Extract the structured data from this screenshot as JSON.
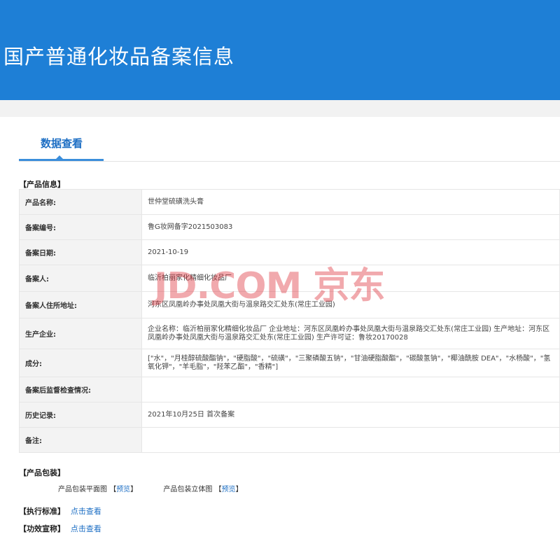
{
  "header": {
    "title": "国产普通化妆品备案信息"
  },
  "tabs": [
    {
      "label": "数据查看"
    }
  ],
  "product_info": {
    "section_title": "【产品信息】",
    "rows": [
      {
        "label": "产品名称:",
        "value": "世仲堂硫磺洗头膏"
      },
      {
        "label": "备案编号:",
        "value": "鲁G妆网备字2021503083"
      },
      {
        "label": "备案日期:",
        "value": "2021-10-19"
      },
      {
        "label": "备案人:",
        "value": "临沂柏丽家化精细化妆品厂"
      },
      {
        "label": "备案人住所地址:",
        "value": "河东区凤凰岭办事处凤凰大街与温泉路交汇处东(常庄工业园)"
      },
      {
        "label": "生产企业:",
        "value": "企业名称：临沂柏丽家化精细化妆品厂 企业地址：河东区凤凰岭办事处凤凰大街与温泉路交汇处东(常庄工业园) 生产地址：河东区凤凰岭办事处凤凰大街与温泉路交汇处东(常庄工业园) 生产许可证：鲁妆20170028"
      },
      {
        "label": "成分:",
        "value": "[\"水\"，\"月桂醇硫酸酯钠\"，\"硬脂酸\"，\"硫磺\"，\"三聚磷酸五钠\"，\"甘油硬脂酸酯\"，\"碳酸氢钠\"，\"椰油酰胺 DEA\"，\"水杨酸\"，\"氢氧化钾\"，\"羊毛脂\"，\"羟苯乙酯\"，\"香精\"]"
      },
      {
        "label": "备案后监督检查情况:",
        "value": ""
      },
      {
        "label": "历史记录:",
        "value": "2021年10月25日 首次备案"
      },
      {
        "label": "备注:",
        "value": ""
      }
    ]
  },
  "packaging": {
    "section_title": "【产品包装】",
    "flat_label": "产品包装平面图",
    "flat_link": "预览",
    "solid_label": "产品包装立体图",
    "solid_link": "预览"
  },
  "standard": {
    "section_title": "【执行标准】",
    "link": "点击查看"
  },
  "efficacy": {
    "section_title": "【功效宣称】",
    "link": "点击查看"
  },
  "watermark": {
    "text": "JD.COM 京东"
  }
}
